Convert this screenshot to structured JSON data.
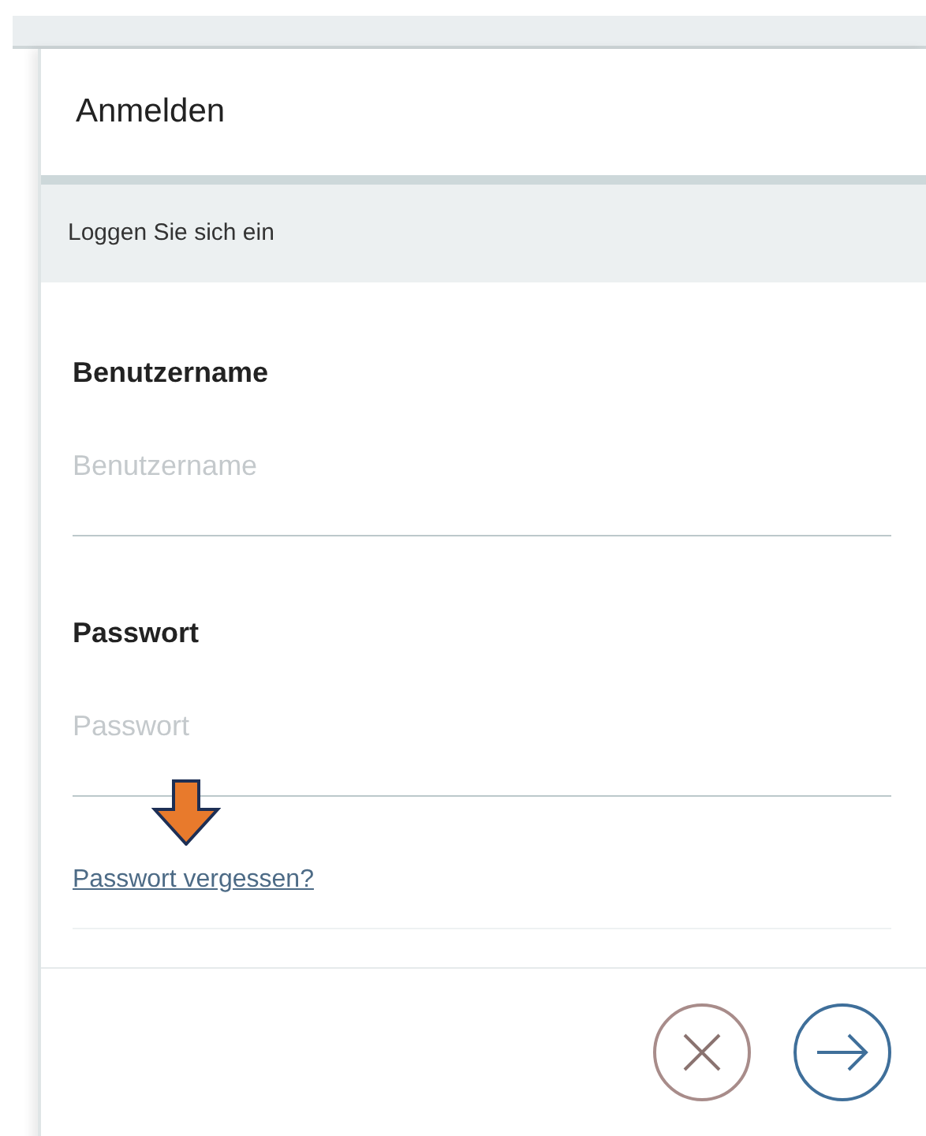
{
  "dialog": {
    "title": "Anmelden",
    "subtitle": "Loggen Sie sich ein"
  },
  "fields": [
    {
      "label": "Benutzername",
      "placeholder": "Benutzername"
    },
    {
      "label": "Passwort",
      "placeholder": "Passwort"
    }
  ],
  "forgot_link": "Passwort vergessen?",
  "annotation_arrow": true
}
